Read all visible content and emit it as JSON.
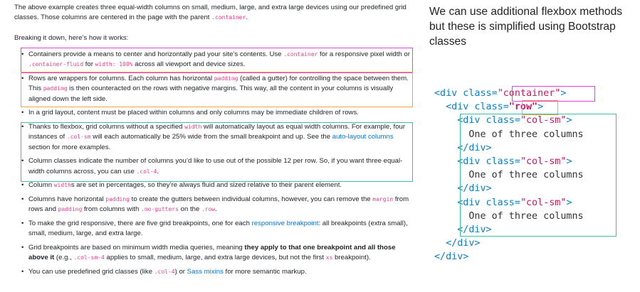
{
  "doc": {
    "intro": [
      "The above example creates three equal-width columns on small, medium, large, and extra large devices using our predefined grid classes. Those columns are centered in the page with the parent ",
      ".container",
      "."
    ],
    "breakdown": "Breaking it down, here’s how it works:",
    "bullets": [
      [
        [
          "Containers provide a means to center and horizontally pad your site’s contents. Use ",
          "t"
        ],
        [
          ".container",
          "c"
        ],
        [
          " for a responsive pixel width or ",
          "t"
        ],
        [
          ".container-fluid",
          "c"
        ],
        [
          " for ",
          "t"
        ],
        [
          "width: 100%",
          "c"
        ],
        [
          " across all viewport and device sizes.",
          "t"
        ]
      ],
      [
        [
          "Rows are wrappers for columns. Each column has horizontal ",
          "t"
        ],
        [
          "padding",
          "c"
        ],
        [
          " (called a gutter) for controlling the space between them. This ",
          "t"
        ],
        [
          "padding",
          "c"
        ],
        [
          " is then counteracted on the rows with negative margins. This way, all the content in your columns is visually aligned down the left side.",
          "t"
        ]
      ],
      [
        [
          "In a grid layout, content must be placed within columns and only columns may be immediate children of rows.",
          "t"
        ]
      ],
      [
        [
          "Thanks to flexbox, grid columns without a specified ",
          "t"
        ],
        [
          "width",
          "c"
        ],
        [
          " will automatically layout as equal width columns. For example, four instances of ",
          "t"
        ],
        [
          ".col-sm",
          "c"
        ],
        [
          " will each automatically be 25% wide from the small breakpoint and up. See the ",
          "t"
        ],
        [
          "auto-layout columns",
          "a"
        ],
        [
          " section for more examples.",
          "t"
        ]
      ],
      [
        [
          "Column classes indicate the number of columns you’d like to use out of the possible 12 per row. So, if you want three equal-width columns across, you can use ",
          "t"
        ],
        [
          ".col-4",
          "c"
        ],
        [
          ".",
          "t"
        ]
      ],
      [
        [
          "Column ",
          "t"
        ],
        [
          "width",
          "c"
        ],
        [
          "s are set in percentages, so they’re always fluid and sized relative to their parent element.",
          "t"
        ]
      ],
      [
        [
          "Columns have horizontal ",
          "t"
        ],
        [
          "padding",
          "c"
        ],
        [
          " to create the gutters between individual columns, however, you can remove the ",
          "t"
        ],
        [
          "margin",
          "c"
        ],
        [
          " from rows and ",
          "t"
        ],
        [
          "padding",
          "c"
        ],
        [
          " from columns with ",
          "t"
        ],
        [
          ".no-gutters",
          "c"
        ],
        [
          " on the ",
          "t"
        ],
        [
          ".row",
          "c"
        ],
        [
          ".",
          "t"
        ]
      ],
      [
        [
          "To make the grid responsive, there are five grid breakpoints, one for each ",
          "t"
        ],
        [
          "responsive breakpoint",
          "a"
        ],
        [
          ": all breakpoints (extra small), small, medium, large, and extra large.",
          "t"
        ]
      ],
      [
        [
          "Grid breakpoints are based on minimum width media queries, meaning ",
          "t"
        ],
        [
          "they apply to that one breakpoint and all those above it",
          "b"
        ],
        [
          " (e.g., ",
          "t"
        ],
        [
          ".col-sm-4",
          "c"
        ],
        [
          " applies to small, medium, large, and extra large devices, but not the first ",
          "t"
        ],
        [
          "xs",
          "c"
        ],
        [
          " breakpoint).",
          "t"
        ]
      ],
      [
        [
          "You can use predefined grid classes (like ",
          "t"
        ],
        [
          ".col-4",
          "c"
        ],
        [
          ") or ",
          "t"
        ],
        [
          "Sass mixins",
          "a"
        ],
        [
          " for more semantic markup.",
          "t"
        ]
      ]
    ]
  },
  "side_text": "We can use additional flexbox methods but these is simplified using Bootstrap classes",
  "code": [
    [
      [
        "<div class=",
        "tag"
      ],
      [
        "\"container\"",
        "str"
      ],
      [
        ">",
        "tag"
      ]
    ],
    [
      [
        "  <div class=",
        "tag"
      ],
      [
        "\"row\"",
        "strb"
      ],
      [
        ">",
        "tag"
      ]
    ],
    [
      [
        "    <div class=",
        "tag"
      ],
      [
        "\"col-sm\"",
        "str"
      ],
      [
        ">",
        "tag"
      ]
    ],
    [
      [
        "      One of three columns",
        "txt"
      ]
    ],
    [
      [
        "    </div>",
        "tag"
      ]
    ],
    [
      [
        "    <div class=",
        "tag"
      ],
      [
        "\"col-sm\"",
        "str"
      ],
      [
        ">",
        "tag"
      ]
    ],
    [
      [
        "      One of three columns",
        "txt"
      ]
    ],
    [
      [
        "    </div>",
        "tag"
      ]
    ],
    [
      [
        "    <div class=",
        "tag"
      ],
      [
        "\"col-sm\"",
        "str"
      ],
      [
        ">",
        "tag"
      ]
    ],
    [
      [
        "      One of three columns",
        "txt"
      ]
    ],
    [
      [
        "    </div>",
        "tag"
      ]
    ],
    [
      [
        "  </div>",
        "tag"
      ]
    ],
    [
      [
        "</div>",
        "tag"
      ]
    ]
  ],
  "colors": {
    "magenta": "#e040e0",
    "orange": "#f5a33a",
    "teal": "#3bbfa3",
    "link": "#0275d8",
    "code_pink": "#e83e8c"
  }
}
